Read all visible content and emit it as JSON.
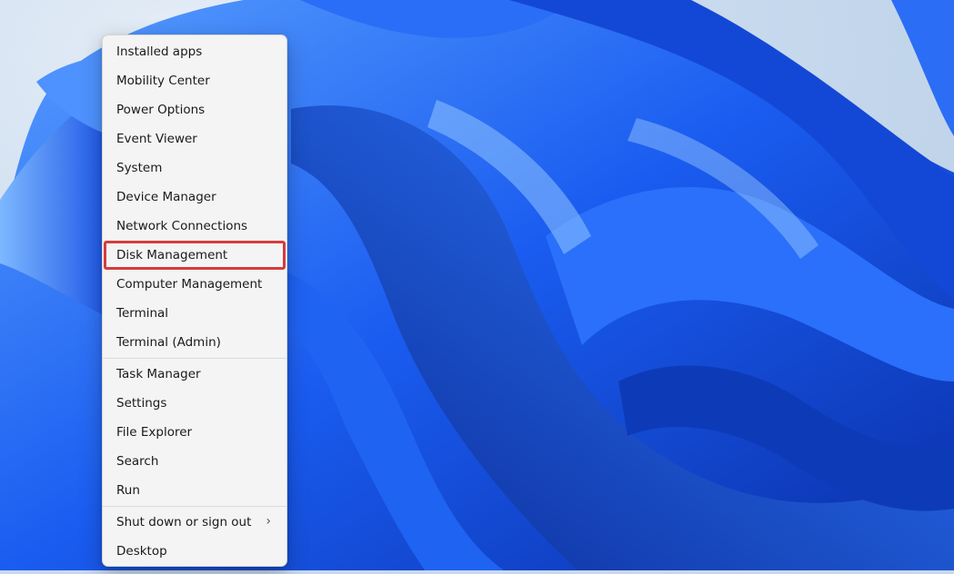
{
  "menu": {
    "groups": [
      {
        "items": [
          {
            "label": "Installed apps"
          },
          {
            "label": "Mobility Center"
          },
          {
            "label": "Power Options"
          },
          {
            "label": "Event Viewer"
          },
          {
            "label": "System"
          },
          {
            "label": "Device Manager"
          },
          {
            "label": "Network Connections"
          },
          {
            "label": "Disk Management",
            "highlighted": true
          },
          {
            "label": "Computer Management"
          },
          {
            "label": "Terminal"
          },
          {
            "label": "Terminal (Admin)"
          }
        ]
      },
      {
        "items": [
          {
            "label": "Task Manager"
          },
          {
            "label": "Settings"
          },
          {
            "label": "File Explorer"
          },
          {
            "label": "Search"
          },
          {
            "label": "Run"
          }
        ]
      },
      {
        "items": [
          {
            "label": "Shut down or sign out",
            "submenu": true,
            "submenu_icon": "chevron-right-icon"
          },
          {
            "label": "Desktop"
          }
        ]
      }
    ]
  },
  "colors": {
    "highlight_outline": "#d63c3c",
    "menu_background": "#f4f4f4",
    "wallpaper_primary": "#0a4fd8"
  }
}
